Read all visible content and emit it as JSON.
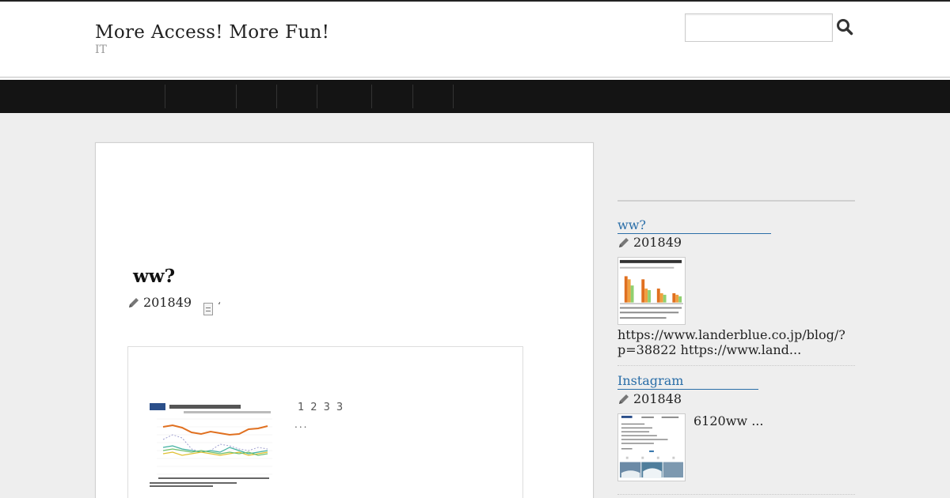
{
  "header": {
    "site_title": "More Access! More Fun!",
    "site_description": "IT",
    "search": {
      "placeholder": "",
      "value": ""
    }
  },
  "nav": {
    "items": [
      "",
      "",
      "",
      "",
      "",
      "",
      "",
      ""
    ]
  },
  "post": {
    "title": "ww?",
    "date": "201849",
    "doc_mark": "ʻ",
    "pagination": [
      "1",
      "2",
      "3",
      "3"
    ],
    "ellipsis": "..."
  },
  "sidebar": {
    "entries": [
      {
        "title": "ww?",
        "date": "201849",
        "excerpt": "https://www.landerblue.co.jp/blog/?p=38822 https://www.land..."
      },
      {
        "title": "Instagram",
        "date": "201848",
        "excerpt": "6120ww ..."
      }
    ]
  },
  "colors": {
    "nav_bg": "#141414",
    "link": "#2a6ea8",
    "page_bg": "#eeeeee"
  }
}
